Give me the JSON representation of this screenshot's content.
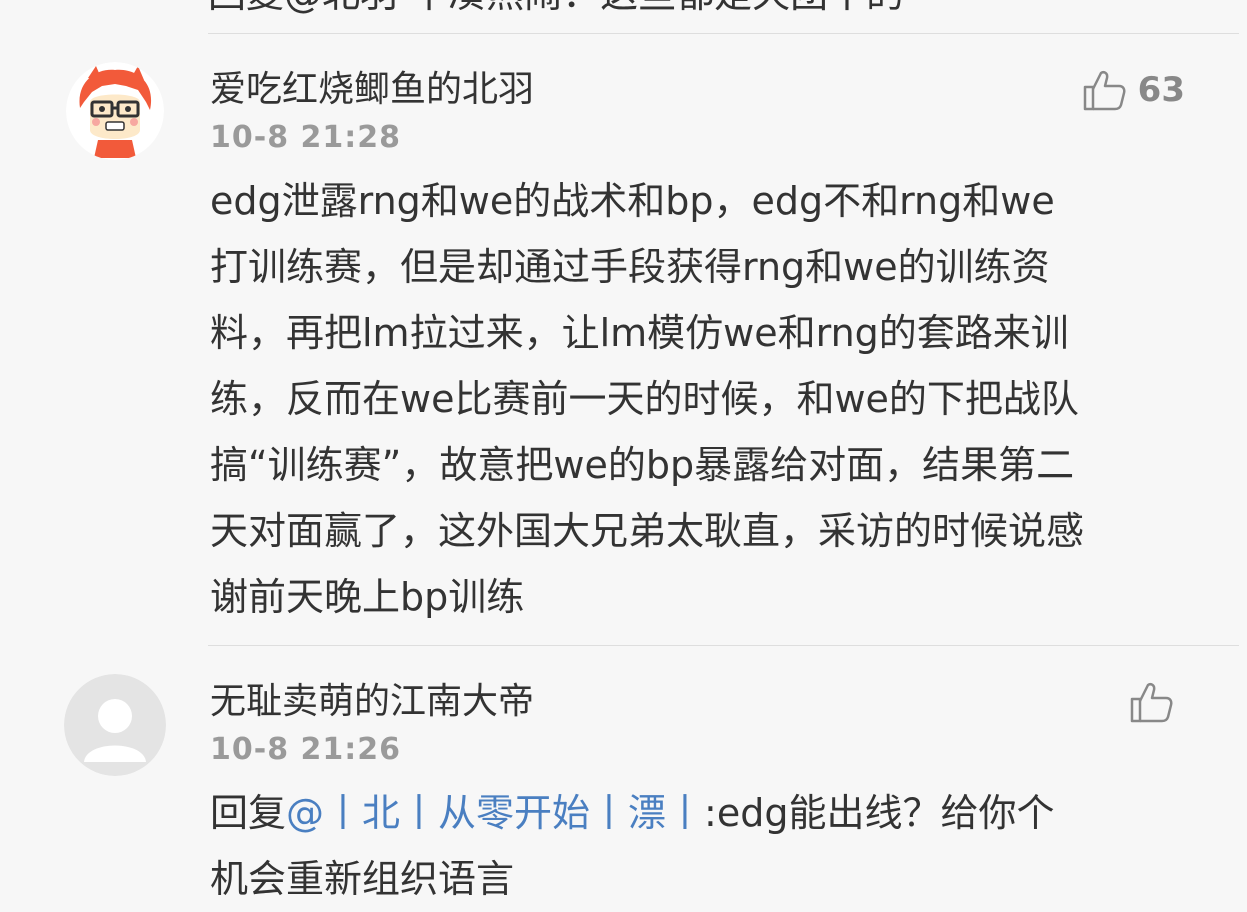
{
  "previous_comment": {
    "partial_text": "回复@北羽 不凑热闹：这些都是天团干的"
  },
  "comments": [
    {
      "username": "爱吃红烧鲫鱼的北羽",
      "timestamp": "10-8 21:28",
      "likes": "63",
      "avatar_icon": "cartoon-glasses-avatar-icon",
      "lines": [
        "edg泄露rng和we的战术和bp，edg不和rng和we",
        "打训练赛，但是却通过手段获得rng和we的训练资",
        "料，再把lm拉过来，让lm模仿we和rng的套路来训",
        "练，反而在we比赛前一天的时候，和we的下把战队",
        "搞“训练赛”，故意把we的bp暴露给对面，结果第二",
        "天对面赢了，这外国大兄弟太耿直，采访的时候说感",
        "谢前天晚上bp训练"
      ]
    },
    {
      "username": "无耻卖萌的江南大帝",
      "timestamp": "10-8 21:26",
      "likes": "",
      "avatar_icon": "default-user-avatar-icon",
      "reply_prefix": "回复",
      "mention": "@丨北丨从零开始丨漂丨",
      "reply_text": ":edg能出线？给你个",
      "line2": "机会重新组织语言"
    }
  ],
  "colors": {
    "background": "#f7f7f7",
    "text": "#333333",
    "meta": "#9a9a9a",
    "mention": "#4a7fc1",
    "divider": "#dedede"
  }
}
